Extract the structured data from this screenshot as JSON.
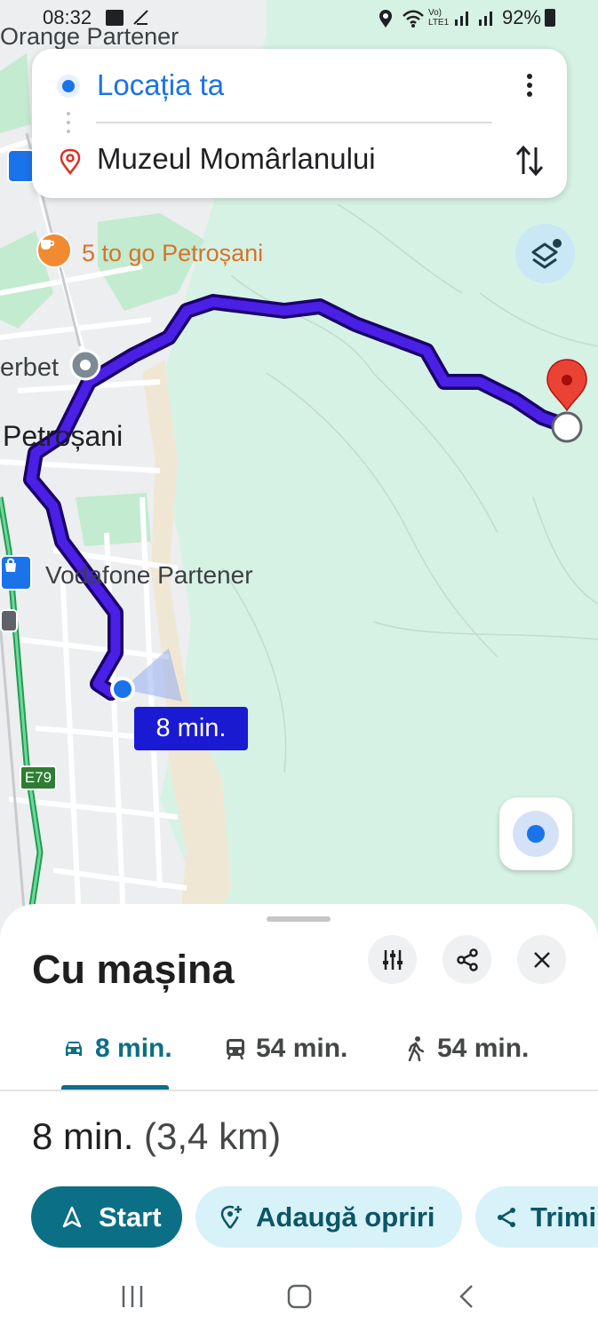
{
  "status_bar": {
    "time": "08:32",
    "battery": "92%"
  },
  "search": {
    "origin": "Locația ta",
    "destination": "Muzeul Momârlanului"
  },
  "map": {
    "labels": {
      "orange": "Orange Partener",
      "cafe": "5 to go Petroșani",
      "erbet": "erbet",
      "city": "Petroșani",
      "vodafone": "Vodafone Partener",
      "road": "E79"
    },
    "eta_badge": "8 min."
  },
  "sheet": {
    "title": "Cu mașina",
    "tabs": [
      {
        "label": "8 min.",
        "icon": "car-icon",
        "active": true
      },
      {
        "label": "54 min.",
        "icon": "transit-icon",
        "active": false
      },
      {
        "label": "54 min.",
        "icon": "walk-icon",
        "active": false
      }
    ],
    "summary_time": "8 min.",
    "summary_distance": "(3,4 km)",
    "buttons": {
      "start": "Start",
      "add_stops": "Adaugă opriri",
      "send": "Trimi"
    }
  },
  "colors": {
    "route": "#3a00d6",
    "accent": "#0b6f86",
    "origin_blue": "#1a73e8",
    "pin_red": "#ea4335"
  }
}
